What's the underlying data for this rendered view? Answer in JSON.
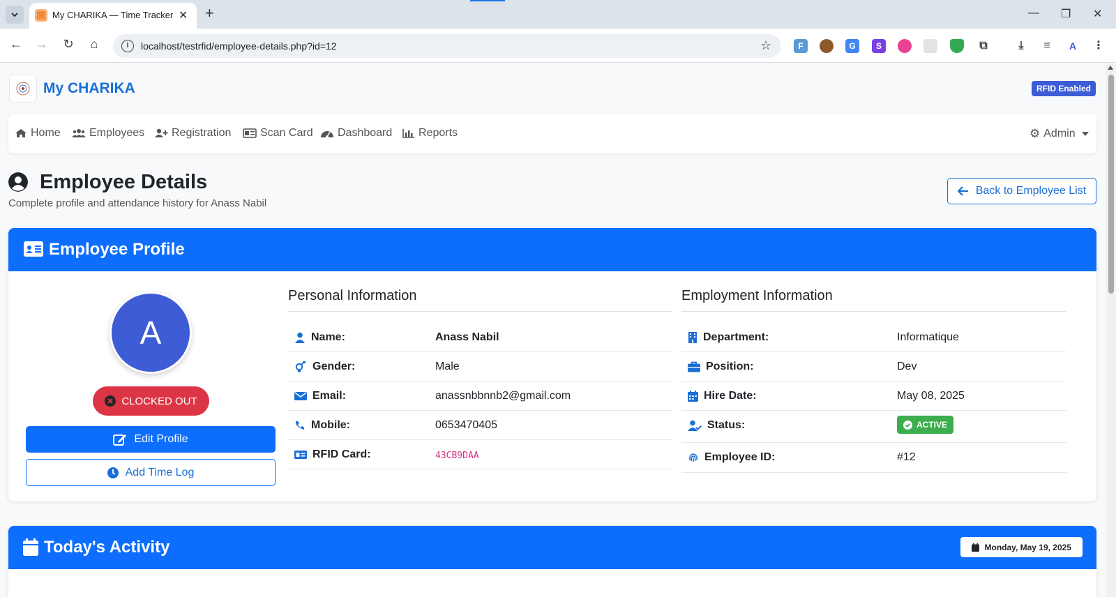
{
  "browser": {
    "tab_title": "My CHARIKA — Time Tracker",
    "url": "localhost/testrfid/employee-details.php?id=12"
  },
  "header": {
    "brand": "My CHARIKA",
    "badge": "RFID Enabled"
  },
  "nav": {
    "items": [
      {
        "label": "Home",
        "icon": "home-icon"
      },
      {
        "label": "Employees",
        "icon": "users-icon"
      },
      {
        "label": "Registration",
        "icon": "user-plus-icon"
      },
      {
        "label": "Scan Card",
        "icon": "id-card-icon"
      },
      {
        "label": "Dashboard",
        "icon": "gauge-icon"
      },
      {
        "label": "Reports",
        "icon": "bar-chart-icon"
      }
    ],
    "admin_label": "Admin"
  },
  "page": {
    "title": "Employee Details",
    "subtitle": "Complete profile and attendance history for Anass Nabil",
    "back_label": "Back to Employee List"
  },
  "profile": {
    "header": "Employee Profile",
    "avatar_letter": "A",
    "status": "CLOCKED OUT",
    "edit_label": "Edit Profile",
    "timelog_label": "Add Time Log",
    "personal_title": "Personal Information",
    "personal": [
      {
        "label": "Name:",
        "value": "Anass Nabil"
      },
      {
        "label": "Gender:",
        "value": "Male"
      },
      {
        "label": "Email:",
        "value": "anassnbbnnb2@gmail.com"
      },
      {
        "label": "Mobile:",
        "value": "0653470405"
      },
      {
        "label": "RFID Card:",
        "value": "43CB9DAA"
      }
    ],
    "employment_title": "Employment Information",
    "employment": [
      {
        "label": "Department:",
        "value": "Informatique"
      },
      {
        "label": "Position:",
        "value": "Dev"
      },
      {
        "label": "Hire Date:",
        "value": "May 08, 2025"
      },
      {
        "label": "Status:",
        "value": "ACTIVE"
      },
      {
        "label": "Employee ID:",
        "value": "#12"
      }
    ]
  },
  "activity": {
    "header": "Today's Activity",
    "date": "Monday, May 19, 2025"
  },
  "colors": {
    "primary": "#0d6efd",
    "danger": "#dc3545",
    "success": "#3cae4e",
    "brand": "#1a6fd6",
    "badge": "#3d5cd6"
  }
}
